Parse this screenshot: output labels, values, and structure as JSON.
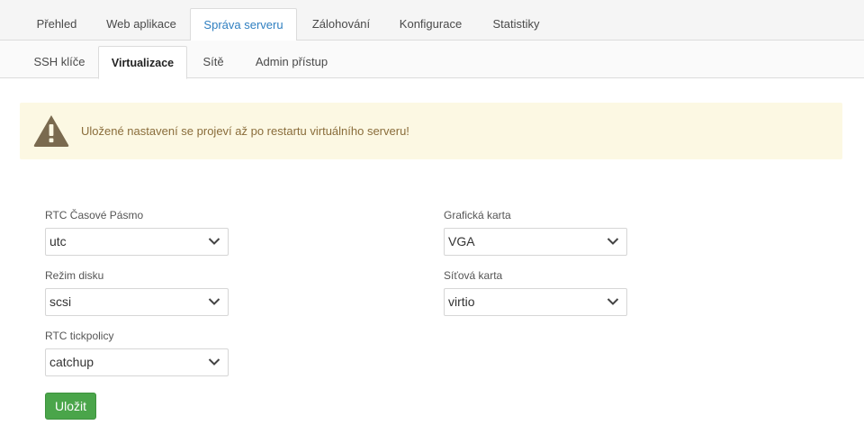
{
  "top_tabs": [
    {
      "label": "Přehled"
    },
    {
      "label": "Web aplikace"
    },
    {
      "label": "Správa serveru",
      "active": true
    },
    {
      "label": "Zálohování"
    },
    {
      "label": "Konfigurace"
    },
    {
      "label": "Statistiky"
    }
  ],
  "sub_tabs": [
    {
      "label": "SSH klíče"
    },
    {
      "label": "Virtualizace",
      "active": true
    },
    {
      "label": "Sítě"
    },
    {
      "label": "Admin přístup"
    }
  ],
  "alert": {
    "text": "Uložené nastavení se projeví až po restartu virtuálního serveru!",
    "icon": "warning-triangle-icon",
    "bg_color": "#fcf8e3",
    "icon_color": "#7a6a4f"
  },
  "form": {
    "rtc_timezone": {
      "label": "RTC Časové Pásmo",
      "value": "utc"
    },
    "disk_mode": {
      "label": "Režim disku",
      "value": "scsi"
    },
    "rtc_tickpolicy": {
      "label": "RTC tickpolicy",
      "value": "catchup"
    },
    "graphics_card": {
      "label": "Grafická karta",
      "value": "VGA"
    },
    "network_card": {
      "label": "Síťová karta",
      "value": "virtio"
    },
    "save_label": "Uložit"
  },
  "colors": {
    "active_top_tab": "#2f7fc0",
    "save_button": "#4aa54a"
  }
}
